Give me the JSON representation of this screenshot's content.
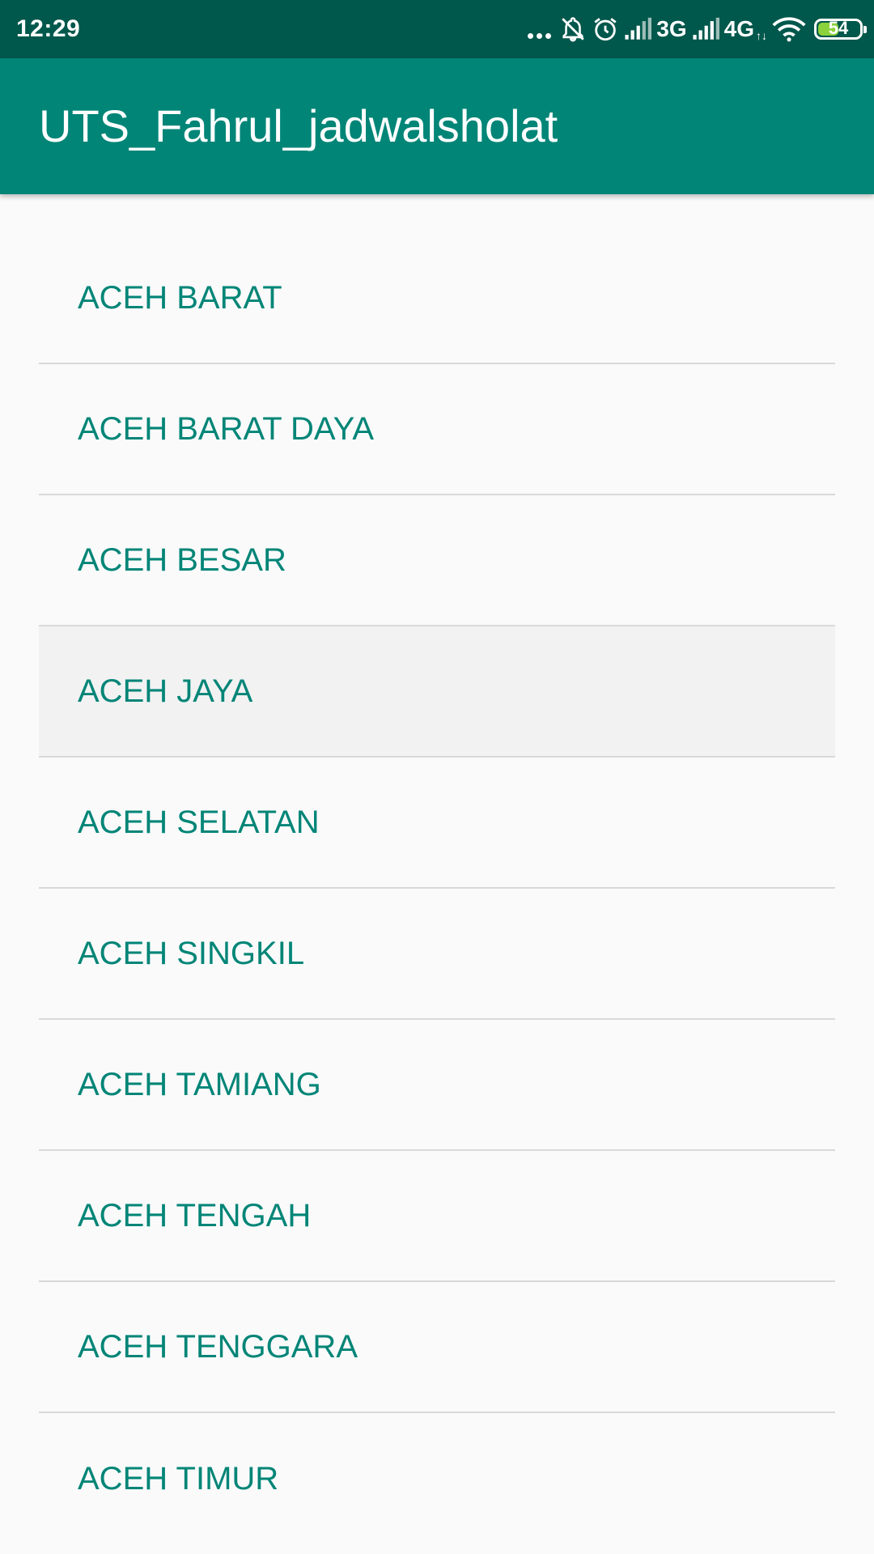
{
  "status_bar": {
    "time": "12:29",
    "network_3g": "3G",
    "network_4g": "4G",
    "network_4g_sub": "↑↓",
    "battery_level": "54",
    "battery_percent": 54,
    "icons": [
      "more-dots-icon",
      "notifications-off-icon",
      "alarm-icon",
      "signal-icon",
      "signal-icon",
      "wifi-icon",
      "battery-icon"
    ]
  },
  "app_bar": {
    "title": "UTS_Fahrul_jadwalsholat",
    "color": "#008577"
  },
  "list": {
    "items": [
      {
        "label": "ACEH BARAT"
      },
      {
        "label": "ACEH BARAT DAYA"
      },
      {
        "label": "ACEH BESAR"
      },
      {
        "label": "ACEH JAYA"
      },
      {
        "label": "ACEH SELATAN"
      },
      {
        "label": "ACEH SINGKIL"
      },
      {
        "label": "ACEH TAMIANG"
      },
      {
        "label": "ACEH TENGAH"
      },
      {
        "label": "ACEH TENGGARA"
      },
      {
        "label": "ACEH TIMUR"
      }
    ],
    "text_color": "#008577"
  }
}
